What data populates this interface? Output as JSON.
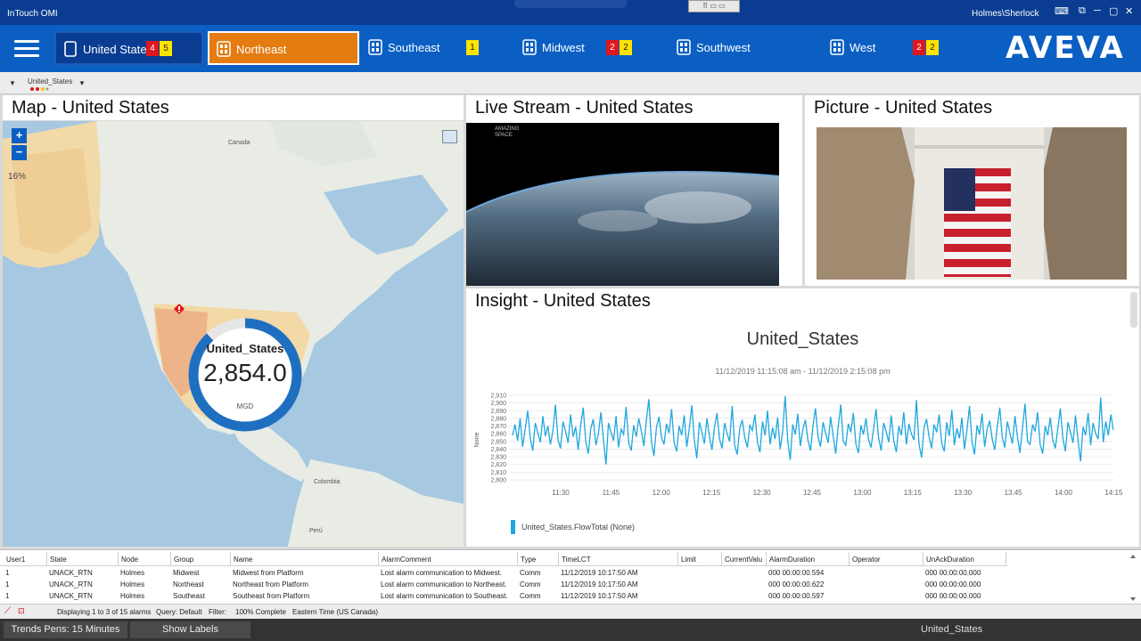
{
  "window": {
    "app_title": "InTouch OMI",
    "user": "Holmes\\Sherlock",
    "mini_toolbar": "⠿ ▭ ▭"
  },
  "nav": {
    "tabs": [
      {
        "label": "United States",
        "alarms": [
          "4",
          "5"
        ],
        "selected": true
      },
      {
        "label": "Northeast",
        "alarms": [],
        "active": true
      },
      {
        "label": "Southeast",
        "alarms": [
          "1"
        ]
      },
      {
        "label": "Midwest",
        "alarms": [
          "2",
          "2"
        ]
      },
      {
        "label": "Southwest",
        "alarms": []
      },
      {
        "label": "West",
        "alarms": [
          "2",
          "2"
        ]
      }
    ],
    "logo": "AVEVA"
  },
  "breadcrumb": {
    "item": "United_States"
  },
  "panels": {
    "map_title": "Map - United States",
    "stream_title": "Live Stream - United States",
    "picture_title": "Picture - United States",
    "insight_title": "Insight - United States"
  },
  "map": {
    "zoom_in": "+",
    "zoom_out": "−",
    "percent": "16%",
    "labels": {
      "canada": "Canada",
      "colombia": "Colombia",
      "peru": "Perú"
    },
    "gauge": {
      "name": "United_States",
      "value": "2,854.0",
      "unit": "MGD",
      "fill": 0.88
    }
  },
  "stream": {
    "watermark": "AMAZING SPACE"
  },
  "chart_data": {
    "type": "line",
    "title": "United_States",
    "subtitle": "11/12/2019 11:15:08 am - 11/12/2019 2:15:08 pm",
    "ylabel": "None",
    "ylim": [
      2800,
      2910
    ],
    "yticks": [
      "2,910",
      "2,900",
      "2,890",
      "2,880",
      "2,870",
      "2,860",
      "2,850",
      "2,840",
      "2,830",
      "2,820",
      "2,810",
      "2,800"
    ],
    "xticks": [
      "11:30",
      "11:45",
      "12:00",
      "12:15",
      "12:30",
      "12:45",
      "13:00",
      "13:15",
      "13:30",
      "13:45",
      "14:00",
      "14:15"
    ],
    "legend": "United_States.FlowTotal (None)",
    "color": "#1fa7df",
    "series": [
      {
        "name": "United_States.FlowTotal (None)",
        "values": [
          2858,
          2872,
          2851,
          2880,
          2843,
          2866,
          2890,
          2855,
          2838,
          2874,
          2861,
          2849,
          2883,
          2857,
          2870,
          2846,
          2864,
          2898,
          2852,
          2841,
          2876,
          2863,
          2848,
          2885,
          2856,
          2869,
          2839,
          2872,
          2894,
          2850,
          2834,
          2867,
          2879,
          2845,
          2860,
          2888,
          2853,
          2820,
          2874,
          2862,
          2851,
          2883,
          2842,
          2866,
          2859,
          2895,
          2848,
          2838,
          2871,
          2856,
          2880,
          2864,
          2844,
          2877,
          2905,
          2850,
          2831,
          2868,
          2882,
          2855,
          2846,
          2873,
          2861,
          2892,
          2849,
          2837,
          2870,
          2858,
          2884,
          2843,
          2866,
          2897,
          2852,
          2828,
          2875,
          2862,
          2847,
          2880,
          2856,
          2839,
          2869,
          2887,
          2853,
          2841,
          2874,
          2860,
          2850,
          2896,
          2845,
          2833,
          2867,
          2878,
          2855,
          2842,
          2871,
          2864,
          2885,
          2849,
          2836,
          2876,
          2858,
          2890,
          2846,
          2868,
          2853,
          2881,
          2840,
          2863,
          2909,
          2851,
          2826,
          2872,
          2859,
          2886,
          2844,
          2866,
          2878,
          2852,
          2838,
          2870,
          2893,
          2856,
          2843,
          2875,
          2861,
          2848,
          2882,
          2857,
          2834,
          2869,
          2898,
          2850,
          2845,
          2873,
          2862,
          2887,
          2847,
          2835,
          2871,
          2859,
          2880,
          2853,
          2842,
          2866,
          2892,
          2855,
          2838,
          2874,
          2863,
          2849,
          2884,
          2851,
          2836,
          2870,
          2858,
          2888,
          2846,
          2873,
          2860,
          2852,
          2904,
          2847,
          2829,
          2868,
          2879,
          2856,
          2841,
          2872,
          2862,
          2885,
          2848,
          2837,
          2875,
          2857,
          2891,
          2845,
          2867,
          2854,
          2881,
          2840,
          2864,
          2896,
          2850,
          2833,
          2871,
          2859,
          2886,
          2843,
          2866,
          2877,
          2853,
          2839,
          2869,
          2894,
          2855,
          2842,
          2876,
          2861,
          2847,
          2883,
          2856,
          2835,
          2868,
          2899,
          2850,
          2846,
          2872,
          2863,
          2888,
          2846,
          2834,
          2870,
          2858,
          2881,
          2852,
          2841,
          2867,
          2893,
          2854,
          2837,
          2875,
          2862,
          2848,
          2884,
          2851,
          2824,
          2869,
          2858,
          2887,
          2845,
          2874,
          2860,
          2853,
          2907,
          2849,
          2876,
          2858,
          2885,
          2865
        ]
      }
    ]
  },
  "alarms": {
    "columns": [
      "User1",
      "State",
      "Node",
      "Group",
      "Name",
      "AlarmComment",
      "Type",
      "TimeLCT",
      "Limit",
      "CurrentValu",
      "AlarmDuration",
      "Operator",
      "UnAckDuration"
    ],
    "rows": [
      [
        "1",
        "UNACK_RTN",
        "Holmes",
        "Midwest",
        "Midwest from Platform",
        "Lost alarm communication to Midwest.",
        "Comm",
        "11/12/2019 10:17:50 AM",
        "",
        "",
        "000 00:00:00.594",
        "",
        "000 00:00:00.000"
      ],
      [
        "1",
        "UNACK_RTN",
        "Holmes",
        "Northeast",
        "Northeast from Platform",
        "Lost alarm communication to Northeast.",
        "Comm",
        "11/12/2019 10:17:50 AM",
        "",
        "",
        "000 00:00:00.622",
        "",
        "000 00:00:00.000"
      ],
      [
        "1",
        "UNACK_RTN",
        "Holmes",
        "Southeast",
        "Southeast from Platform",
        "Lost alarm communication to Southeast.",
        "Comm",
        "11/12/2019 10:17:50 AM",
        "",
        "",
        "000 00:00:00.597",
        "",
        "000 00:00:00.000"
      ]
    ]
  },
  "status": {
    "displaying": "Displaying 1 to 3 of 15 alarms",
    "query": "Query: Default",
    "filter": "Filter:",
    "complete": "100% Complete",
    "timezone": "Eastern Time (US  Canada)"
  },
  "bottom": {
    "trends": "Trends Pens: 15 Minutes",
    "labels": "Show Labels",
    "context": "United_States"
  }
}
